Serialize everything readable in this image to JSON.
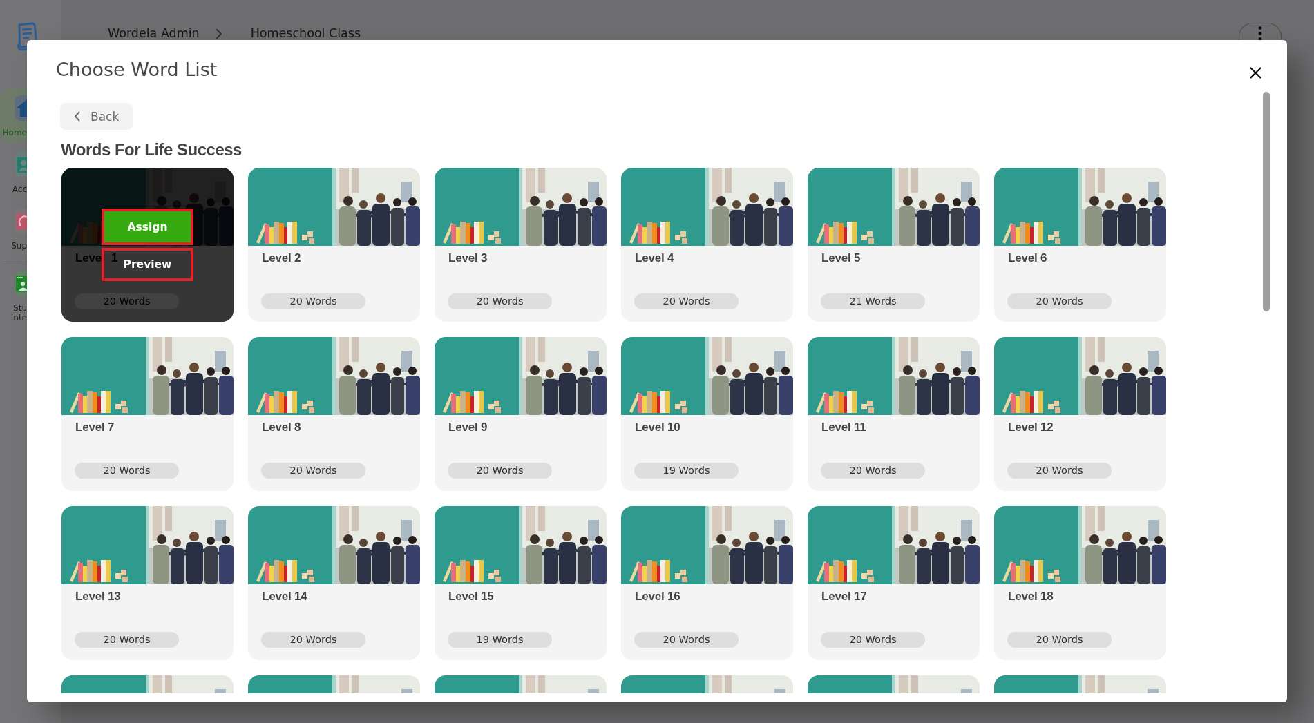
{
  "page": {
    "sidebar": {
      "items": [
        {
          "lines": [
            "Home"
          ],
          "selected": true,
          "divider_before": false,
          "color": "#1d4d80"
        },
        {
          "lines": [
            "Acc"
          ],
          "selected": false,
          "divider_before": false,
          "color": "#1f8072"
        },
        {
          "lines": [
            "Sup"
          ],
          "selected": false,
          "divider_before": false,
          "color": "#c4566a"
        },
        {
          "lines": [
            "Stu",
            "Inte"
          ],
          "selected": false,
          "divider_before": true,
          "color": "#1f8a2c"
        }
      ]
    },
    "breadcrumb": [
      {
        "label": "Wordela Admin"
      },
      {
        "label": "Homeschool Class"
      }
    ]
  },
  "modal": {
    "title": "Choose Word List",
    "back_label": "Back",
    "section_title": "Words For Life Success",
    "hover_actions": [
      {
        "label": "Assign",
        "kind": "primary",
        "highlighted": true
      },
      {
        "label": "Preview",
        "kind": "secondary",
        "highlighted": true
      }
    ],
    "cards": [
      {
        "kind": "full",
        "title": "Leve",
        "title_end": "1",
        "words": "20 Words",
        "hovered": true
      },
      {
        "kind": "full",
        "title": "Level 2",
        "words": "20 Words",
        "hovered": false
      },
      {
        "kind": "full",
        "title": "Level 3",
        "words": "20 Words",
        "hovered": false
      },
      {
        "kind": "full",
        "title": "Level 4",
        "words": "20 Words",
        "hovered": false
      },
      {
        "kind": "full",
        "title": "Level 5",
        "words": "21 Words",
        "hovered": false
      },
      {
        "kind": "full",
        "title": "Level 6",
        "words": "20 Words",
        "hovered": false
      },
      {
        "kind": "full",
        "title": "Level 7",
        "words": "20 Words",
        "hovered": false
      },
      {
        "kind": "full",
        "title": "Level 8",
        "words": "20 Words",
        "hovered": false
      },
      {
        "kind": "full",
        "title": "Level 9",
        "words": "20 Words",
        "hovered": false
      },
      {
        "kind": "full",
        "title": "Level 10",
        "words": "19 Words",
        "hovered": false
      },
      {
        "kind": "full",
        "title": "Level 11",
        "words": "20 Words",
        "hovered": false
      },
      {
        "kind": "full",
        "title": "Level 12",
        "words": "20 Words",
        "hovered": false
      },
      {
        "kind": "full",
        "title": "Level 13",
        "words": "20 Words",
        "hovered": false
      },
      {
        "kind": "full",
        "title": "Level 14",
        "words": "20 Words",
        "hovered": false
      },
      {
        "kind": "full",
        "title": "Level 15",
        "words": "19 Words",
        "hovered": false
      },
      {
        "kind": "full",
        "title": "Level 16",
        "words": "20 Words",
        "hovered": false
      },
      {
        "kind": "full",
        "title": "Level 17",
        "words": "20 Words",
        "hovered": false
      },
      {
        "kind": "full",
        "title": "Level 18",
        "words": "20 Words",
        "hovered": false
      },
      {
        "kind": "clipped",
        "hovered": false
      },
      {
        "kind": "clipped",
        "hovered": false
      },
      {
        "kind": "clipped",
        "hovered": false
      },
      {
        "kind": "clipped",
        "hovered": false
      },
      {
        "kind": "clipped",
        "hovered": false
      },
      {
        "kind": "clipped",
        "hovered": false
      }
    ]
  }
}
